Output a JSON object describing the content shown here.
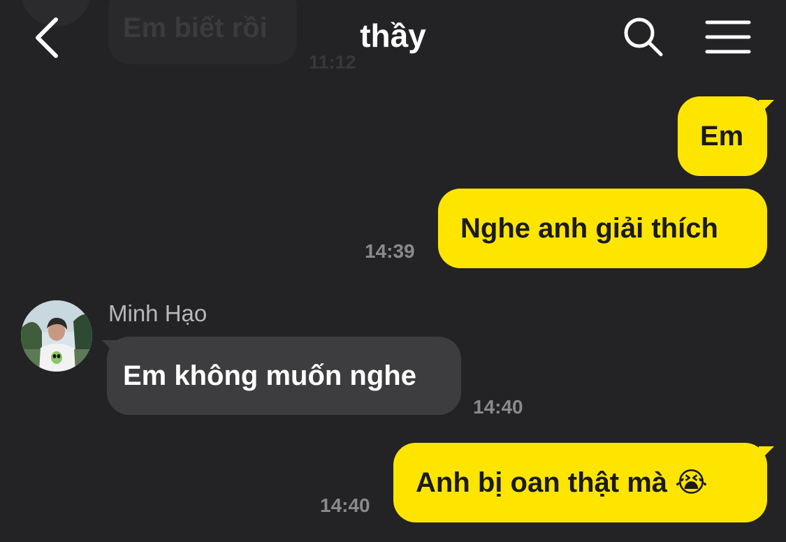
{
  "header": {
    "title": "thầy",
    "back_icon": "chevron-left-icon",
    "search_icon": "search-icon",
    "menu_icon": "menu-icon"
  },
  "previous_message": {
    "text": "Em biết rồi",
    "time": "11:12"
  },
  "messages": [
    {
      "direction": "out",
      "text": "Em"
    },
    {
      "direction": "out",
      "text": "Nghe anh giải thích",
      "time": "14:39"
    },
    {
      "direction": "in",
      "sender": "Minh Hạo",
      "text": "Em không muốn nghe",
      "time": "14:40"
    },
    {
      "direction": "out",
      "text": "Anh bị oan thật mà 😭",
      "time": "14:40"
    }
  ],
  "colors": {
    "background": "#232325",
    "outgoing_bubble": "#fee500",
    "incoming_bubble": "#3d3d3f",
    "timestamp": "#8a8a8c"
  }
}
